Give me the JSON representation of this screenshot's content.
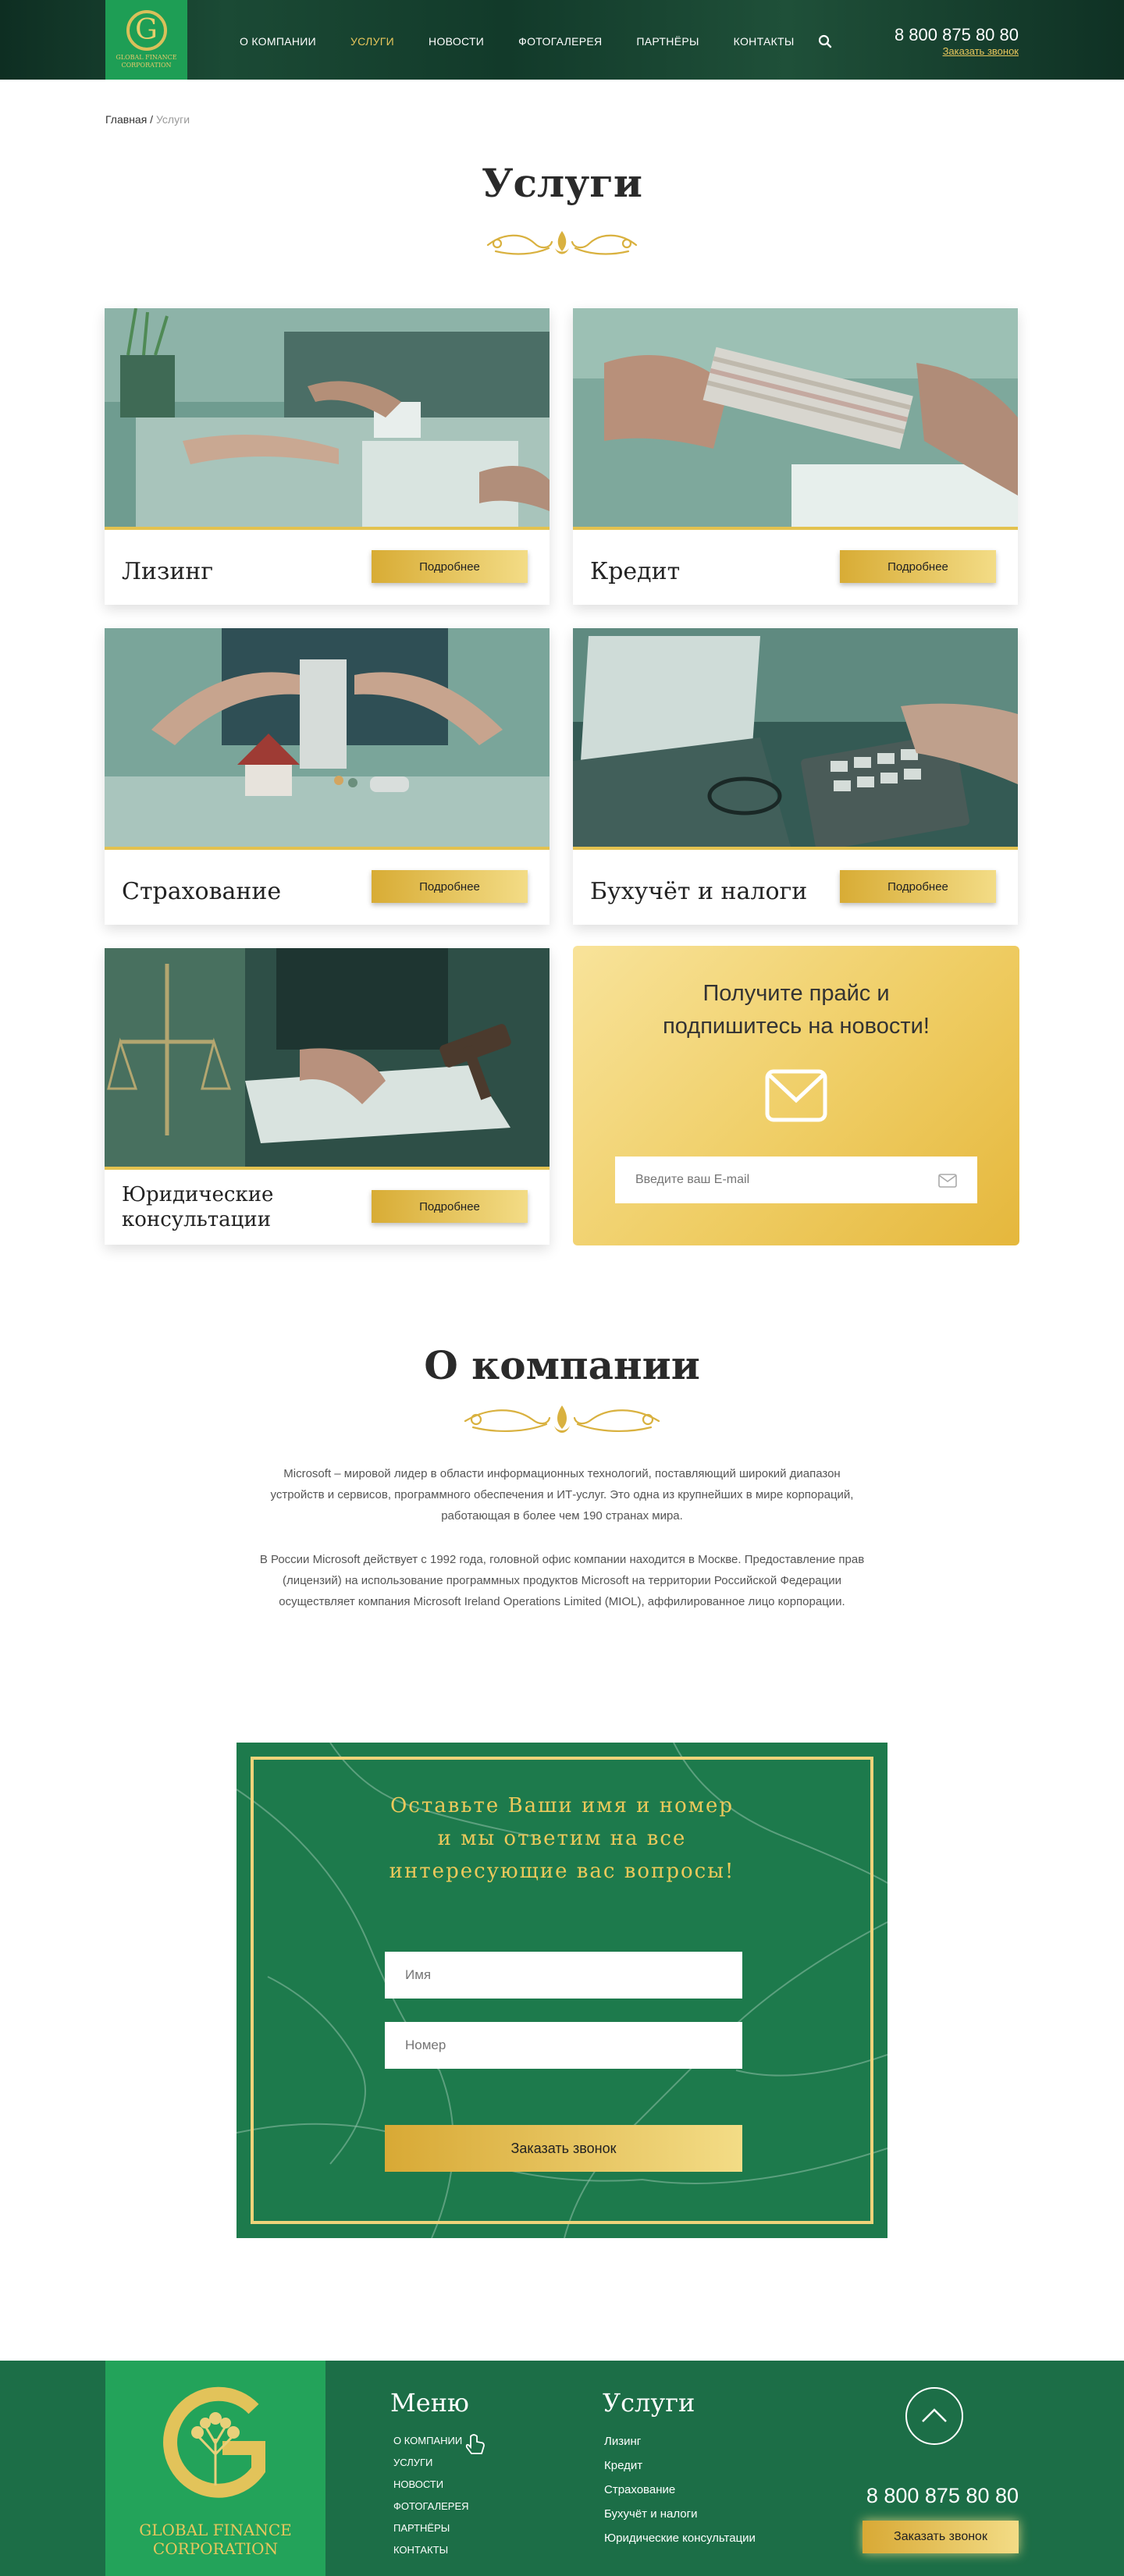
{
  "header": {
    "logo_text": "GLOBAL FINANCE CORPORATION",
    "logo_letter": "G",
    "nav": [
      {
        "label": "О компании",
        "active": false
      },
      {
        "label": "Услуги",
        "active": true
      },
      {
        "label": "Новости",
        "active": false
      },
      {
        "label": "Фотогалерея",
        "active": false
      },
      {
        "label": "Партнёры",
        "active": false
      },
      {
        "label": "Контакты",
        "active": false
      }
    ],
    "phone": "8 800 875 80 80",
    "callback": "Заказать звонок"
  },
  "breadcrumb": {
    "home": "Главная",
    "sep": " / ",
    "current": "Услуги"
  },
  "services": {
    "title": "Услуги",
    "more_label": "Подробнее",
    "cards": [
      {
        "title": "Лизинг"
      },
      {
        "title": "Кредит"
      },
      {
        "title": "Страхование"
      },
      {
        "title": "Бухучёт и налоги"
      },
      {
        "title": "Юридические консультации"
      }
    ]
  },
  "subscribe": {
    "heading": "Получите прайс и подпишитесь на новости!",
    "email_placeholder": "Введите ваш E-mail"
  },
  "about": {
    "title": "О компании",
    "p1": "Microsoft – мировой лидер в области информационных технологий, поставляющий широкий диапазон устройств и сервисов, программного обеспечения и ИТ-услуг. Это одна из крупнейших в мире корпораций, работающая в более чем 190 странах мира.",
    "p2": "В России Microsoft действует с 1992 года, головной офис компании находится в Москве. Предоставление прав (лицензий) на использование программных продуктов Microsoft на территории Российской Федерации осуществляет компания Microsoft Ireland Operations Limited (MIOL), аффилированное лицо корпорации."
  },
  "contact_form": {
    "heading": "Оставьте Ваши имя и номер и мы ответим на все интересующие вас вопросы!",
    "name_placeholder": "Имя",
    "phone_placeholder": "Номер",
    "submit": "Заказать звонок"
  },
  "footer": {
    "logo_text": "GLOBAL FINANCE CORPORATION",
    "menu_title": "Меню",
    "menu": [
      "О компании",
      "Услуги",
      "Новости",
      "Фотогалерея",
      "Партнёры",
      "Контакты"
    ],
    "services_title": "Услуги",
    "services": [
      "Лизинг",
      "Кредит",
      "Страхование",
      "Бухучёт и налоги",
      "Юридические консультации"
    ],
    "phone": "8 800 875 80 80",
    "callback": "Заказать звонок"
  },
  "colors": {
    "brand_green": "#1e9e55",
    "gold": "#e3c24f",
    "dark_green": "#1c6e47"
  }
}
